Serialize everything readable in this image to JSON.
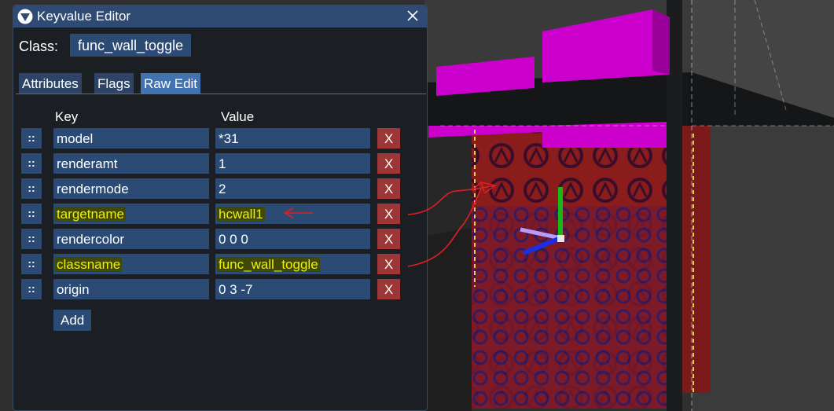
{
  "window": {
    "title": "Keyvalue Editor",
    "class_label": "Class:",
    "class_value": "func_wall_toggle"
  },
  "tabs": [
    {
      "label": "Attributes",
      "active": false
    },
    {
      "label": "Flags",
      "active": false
    },
    {
      "label": "Raw Edit",
      "active": true
    }
  ],
  "table": {
    "key_header": "Key",
    "value_header": "Value",
    "drag_glyph": "::",
    "delete_glyph": "X",
    "rows": [
      {
        "key": "model",
        "value": "*31",
        "highlight_key": false,
        "highlight_value": false
      },
      {
        "key": "renderamt",
        "value": "1",
        "highlight_key": false,
        "highlight_value": false
      },
      {
        "key": "rendermode",
        "value": "2",
        "highlight_key": false,
        "highlight_value": false
      },
      {
        "key": "targetname",
        "value": "hcwall1",
        "highlight_key": true,
        "highlight_value": true
      },
      {
        "key": "rendercolor",
        "value": "0 0 0",
        "highlight_key": false,
        "highlight_value": false
      },
      {
        "key": "classname",
        "value": "func_wall_toggle",
        "highlight_key": true,
        "highlight_value": true
      },
      {
        "key": "origin",
        "value": "0 3 -7",
        "highlight_key": false,
        "highlight_value": false
      }
    ]
  },
  "add_label": "Add",
  "icons": {
    "title": "triangle-down-icon",
    "close": "close-icon",
    "drag": "drag-handle-icon",
    "gizmo": "move-gizmo-icon"
  },
  "colors": {
    "title_bar": "#2f4a73",
    "field_bg": "#2b4b75",
    "tab_active": "#4272b0",
    "delete_bg": "#9b3737",
    "highlight_text": "#f4f000",
    "magenta_brush": "#cc00cc",
    "wall_red": "#8a1c1c",
    "annotation_red": "#e02020"
  }
}
